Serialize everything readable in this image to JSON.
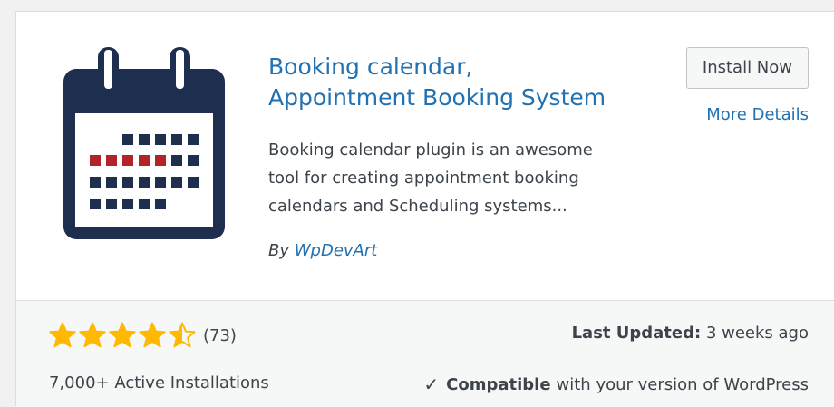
{
  "plugin": {
    "name_line1": "Booking calendar,",
    "name_line2": "Appointment Booking System",
    "description_lines": [
      "Booking calendar plugin is an awesome",
      "tool for creating appointment booking",
      "calendars and Scheduling systems..."
    ],
    "author_prefix": "By",
    "author_name": "WpDevArt",
    "icon": "calendar-icon"
  },
  "actions": {
    "install_label": "Install Now",
    "more_details_label": "More Details"
  },
  "footer": {
    "rating": {
      "stars_value": 4.5,
      "stars_max": 5,
      "num_ratings": "(73)"
    },
    "active_installs": "7,000+ Active Installations",
    "last_updated_label": "Last Updated:",
    "last_updated_value": "3 weeks ago",
    "compatible_label": "Compatible",
    "compatible_suffix": "with your version of WordPress"
  },
  "colors": {
    "star": "#ffb900",
    "link": "#2271b1",
    "icon_navy": "#1e2e4f",
    "icon_red": "#b3232a"
  }
}
